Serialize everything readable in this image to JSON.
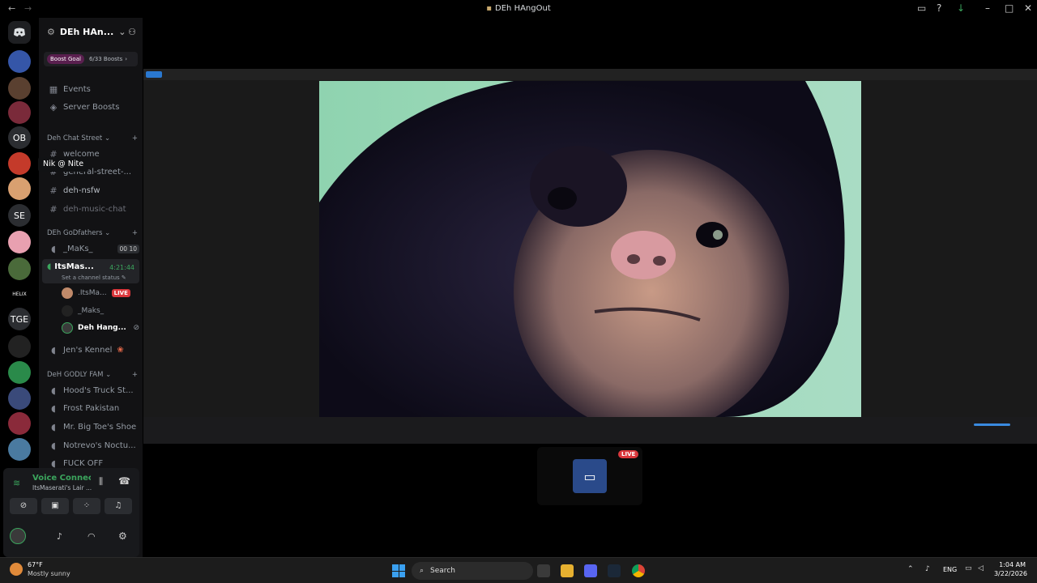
{
  "window": {
    "title": "DEh HAngOut"
  },
  "server": {
    "name": "DEh HAn...",
    "boost_label": "Boost Goal",
    "boost_count": "6/33 Boosts"
  },
  "sidebar": {
    "events": "Events",
    "server_boosts": "Server Boosts",
    "cat1": "Deh Chat Street",
    "ch_welcome": "welcome",
    "ch_general": "general-street-...",
    "ch_nsfw": "deh-nsfw",
    "ch_music": "deh-music-chat",
    "cat2": "DEh GoDfathers",
    "vc_maks": "_MaKs_",
    "vc_maks_n1": "00",
    "vc_maks_n2": "10",
    "vc_itsmas": "ItsMas...",
    "vc_timer": "4:21:44",
    "vc_status": "Set a channel status",
    "user1": ".ItsMa...",
    "user1_badge": "LIVE",
    "user2": "_Maks_",
    "user3": "Deh Hang...",
    "vc_jens": "Jen's Kennel",
    "cat3": "DeH GODLY FAM",
    "vc_hoods": "Hood's Truck St...",
    "vc_frost": "Frost Pakistan",
    "vc_bigtoe": "Mr. Big Toe's Shoe",
    "vc_notrevo": "Notrevo's Noctu...",
    "vc_fuck": "FUCK OFF"
  },
  "tooltip": "Nik @ Nite",
  "rail": {
    "ob": "OB",
    "se": "SE",
    "tge": "TGE",
    "helix": "HELIX"
  },
  "voice": {
    "status": "Voice Connected",
    "channel": "ItsMaserati's Lair ..."
  },
  "stream": {
    "live_badge": "LIVE"
  },
  "taskbar": {
    "weather_temp": "67°F",
    "weather_desc": "Mostly sunny",
    "search": "Search",
    "lang": "ENG",
    "time": "1:04 AM",
    "date": "3/22/2026"
  },
  "icons": [
    "discord-icon",
    "search-icon",
    "mic-icon",
    "headphones-icon",
    "gear-icon",
    "windows-icon",
    "chrome-icon",
    "steam-icon",
    "folder-icon"
  ]
}
